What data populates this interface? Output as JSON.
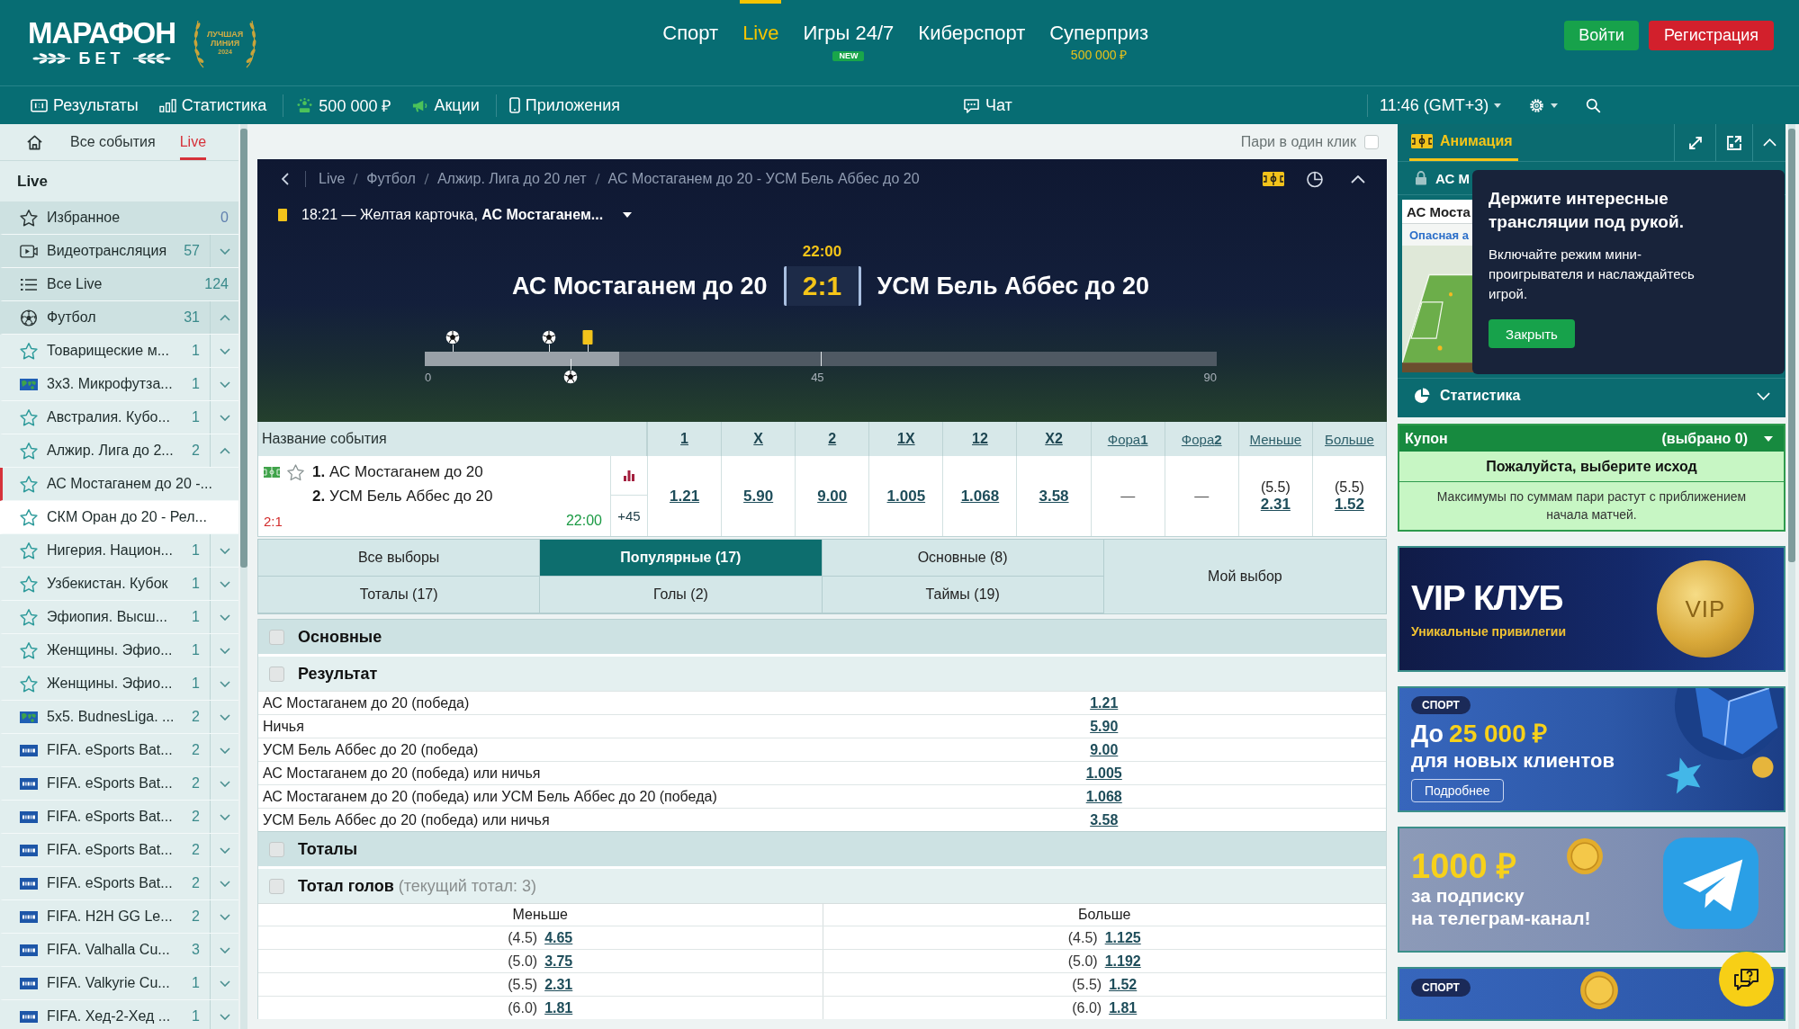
{
  "header": {
    "logo": {
      "title": "МАРАФОН",
      "subtitle": "БЕТ"
    },
    "award": [
      "ЛУЧШАЯ",
      "ЛИНИЯ",
      "2024"
    ],
    "nav": [
      {
        "label": "Спорт",
        "selected": false
      },
      {
        "label": "Live",
        "selected": true
      },
      {
        "label": "Игры 24/7",
        "selected": false,
        "badge": "NEW"
      },
      {
        "label": "Киберспорт",
        "selected": false
      },
      {
        "label": "Суперприз",
        "selected": false,
        "sublabel": "500 000 ₽"
      }
    ],
    "buttons": [
      {
        "label": "Войти",
        "kind": "login"
      },
      {
        "label": "Регистрация",
        "kind": "register"
      }
    ]
  },
  "toolbar": {
    "left": [
      [
        {
          "label": "Результаты",
          "kind": "results"
        },
        {
          "label": "Статистика",
          "kind": "stats"
        }
      ],
      [
        {
          "label": "500 000 ₽",
          "kind": "prize"
        },
        {
          "label": "Акции",
          "kind": "promo"
        }
      ],
      [
        {
          "label": "Приложения",
          "kind": "apps"
        }
      ]
    ],
    "right": [
      [
        {
          "label": "Чат",
          "kind": "chat"
        }
      ],
      [
        {
          "label": "11:46 (GMT+3)",
          "kind": "time"
        },
        {
          "kind": "settings"
        },
        {
          "kind": "search"
        }
      ]
    ]
  },
  "sidebar": {
    "tabs": [
      {
        "label": "Все события",
        "selected": false
      },
      {
        "label": "Live",
        "selected": true
      }
    ],
    "title": "Live",
    "items": [
      {
        "label": "Избранное",
        "kind": "favorites",
        "count": "0",
        "selected": false
      },
      {
        "label": "Видеотрансляция",
        "kind": "video",
        "count": "57",
        "expanded": false,
        "selected": false
      },
      {
        "label": "Все Live",
        "kind": "all",
        "count": "124",
        "selected": false
      },
      {
        "label": "Футбол",
        "kind": "sport",
        "count": "31",
        "expanded": true,
        "selected": false,
        "children": [
          {
            "label": "Товарищеские м...",
            "kind": "star",
            "count": "1",
            "expanded": false,
            "selected": false
          },
          {
            "label": "3x3. Микрофутза...",
            "kind": "world",
            "count": "1",
            "expanded": false,
            "selected": false
          },
          {
            "label": "Австралия. Кубо...",
            "kind": "star",
            "count": "1",
            "expanded": false,
            "selected": false
          },
          {
            "label": "Алжир. Лига до 2...",
            "kind": "star",
            "count": "2",
            "expanded": true,
            "selected": false,
            "children": [
              {
                "label": "АС Мостаганем до 20 -...",
                "kind": "star",
                "selected": true,
                "hovered": false
              },
              {
                "label": "СКМ Оран до 20 - Рел...",
                "kind": "star",
                "selected": false,
                "hovered": true
              }
            ]
          },
          {
            "label": "Нигерия. Национ...",
            "kind": "star",
            "count": "1",
            "expanded": false,
            "selected": false
          },
          {
            "label": "Узбекистан. Кубок",
            "kind": "star",
            "count": "1",
            "expanded": false,
            "selected": false
          },
          {
            "label": "Эфиопия. Высш...",
            "kind": "star",
            "count": "1",
            "expanded": false,
            "selected": false
          },
          {
            "label": "Женщины. Эфио...",
            "kind": "star",
            "count": "1",
            "expanded": false,
            "selected": false
          },
          {
            "label": "Женщины. Эфио...",
            "kind": "star",
            "count": "1",
            "expanded": false,
            "selected": false
          },
          {
            "label": "5x5. BudnesLiga. ...",
            "kind": "world",
            "count": "2",
            "expanded": false,
            "selected": false
          },
          {
            "label": "FIFA. eSports Bat...",
            "kind": "fifa",
            "count": "2",
            "expanded": false,
            "selected": false
          },
          {
            "label": "FIFA. eSports Bat...",
            "kind": "fifa",
            "count": "2",
            "expanded": false,
            "selected": false
          },
          {
            "label": "FIFA. eSports Bat...",
            "kind": "fifa",
            "count": "2",
            "expanded": false,
            "selected": false
          },
          {
            "label": "FIFA. eSports Bat...",
            "kind": "fifa",
            "count": "2",
            "expanded": false,
            "selected": false
          },
          {
            "label": "FIFA. eSports Bat...",
            "kind": "fifa",
            "count": "2",
            "expanded": false,
            "selected": false
          },
          {
            "label": "FIFA. H2H GG Le...",
            "kind": "fifa",
            "count": "2",
            "expanded": false,
            "selected": false
          },
          {
            "label": "FIFA. Valhalla Cu...",
            "kind": "fifa",
            "count": "3",
            "expanded": false,
            "selected": false
          },
          {
            "label": "FIFA. Valkyrie Cu...",
            "kind": "fifa",
            "count": "1",
            "expanded": false,
            "selected": false
          },
          {
            "label": "FIFA. Хед-2-Хед ...",
            "kind": "fifa",
            "count": "1",
            "expanded": false,
            "selected": false
          }
        ]
      }
    ]
  },
  "one_click": {
    "label": "Пари в один клик",
    "checked": false
  },
  "event": {
    "breadcrumbs": [
      "Live",
      "Футбол",
      "Алжир. Лига до 20 лет",
      "АС Мостаганем до 20 - УСМ Бель Аббес до 20"
    ],
    "incident": "18:21 — Желтая карточка, **АС Мостаганем...**",
    "clock": "22:00",
    "home": "АС Мостаганем до 20",
    "score": "2:1",
    "away": "УСМ Бель Аббес до 20",
    "timeline": {
      "level": 0.246,
      "ticks": [
        "0",
        "45",
        "90"
      ],
      "events": [
        {
          "kind": "goal-home",
          "level": 0.035
        },
        {
          "kind": "goal-home",
          "level": 0.157
        },
        {
          "kind": "goal-away",
          "level": 0.184
        },
        {
          "kind": "card-home",
          "level": 0.206
        }
      ]
    }
  },
  "odds_table": {
    "name_header": "Название события",
    "columns": [
      {
        "label": "1",
        "kind": "outcome"
      },
      {
        "label": "X",
        "kind": "outcome"
      },
      {
        "label": "2",
        "kind": "outcome"
      },
      {
        "label": "1X",
        "kind": "outcome"
      },
      {
        "label": "12",
        "kind": "outcome"
      },
      {
        "label": "X2",
        "kind": "outcome"
      },
      {
        "label": "Фора**1**",
        "kind": "handicap"
      },
      {
        "label": "Фора**2**",
        "kind": "handicap"
      },
      {
        "label": "Меньше",
        "kind": "total"
      },
      {
        "label": "Больше",
        "kind": "total"
      }
    ],
    "rows": [
      {
        "teams": [
          "**1.** АС Мостаганем до 20",
          "**2.** УСМ Бель Аббес до 20"
        ],
        "favorite": false,
        "score": "2:1",
        "time": "22:00",
        "more": "+45",
        "odds": [
          {
            "kind": "price",
            "value": "1.21"
          },
          {
            "kind": "price",
            "value": "5.90"
          },
          {
            "kind": "price",
            "value": "9.00"
          },
          {
            "kind": "price",
            "value": "1.005"
          },
          {
            "kind": "price",
            "value": "1.068"
          },
          {
            "kind": "price",
            "value": "3.58"
          },
          {
            "kind": "empty",
            "value": "—"
          },
          {
            "kind": "empty",
            "value": "—"
          },
          {
            "kind": "total",
            "line": "(5.5)",
            "value": "2.31"
          },
          {
            "kind": "total",
            "line": "(5.5)",
            "value": "1.52"
          }
        ]
      }
    ]
  },
  "market_tabs": {
    "tabs": [
      {
        "label": "Все выборы",
        "selected": false
      },
      {
        "label": "Популярные (17)",
        "selected": true
      },
      {
        "label": "Основные (8)",
        "selected": false
      },
      {
        "label": "Тоталы (17)",
        "selected": false
      },
      {
        "label": "Голы (2)",
        "selected": false
      },
      {
        "label": "Таймы (19)",
        "selected": false
      }
    ],
    "my_choice": "Мой выбор"
  },
  "markets": [
    {
      "kind": "group",
      "title": "Основные",
      "checked": false
    },
    {
      "kind": "market",
      "title": "Результат",
      "checked": false,
      "rows": [
        {
          "label": "АС Мостаганем до 20 (победа)",
          "odd": "1.21"
        },
        {
          "label": "Ничья",
          "odd": "5.90"
        },
        {
          "label": "УСМ Бель Аббес до 20 (победа)",
          "odd": "9.00"
        },
        {
          "label": "АС Мостаганем до 20 (победа) или ничья",
          "odd": "1.005"
        },
        {
          "label": "АС Мостаганем до 20 (победа) или УСМ Бель Аббес до 20 (победа)",
          "odd": "1.068"
        },
        {
          "label": "УСМ Бель Аббес до 20 (победа) или ничья",
          "odd": "3.58"
        }
      ]
    },
    {
      "kind": "group",
      "title": "Тоталы",
      "checked": false
    },
    {
      "kind": "totals",
      "title": "**Тотал голов** (текущий тотал: 3)",
      "checked": false,
      "columns": [
        "Меньше",
        "Больше"
      ],
      "rows": [
        [
          {
            "line": "(4.5)",
            "odd": "4.65"
          },
          {
            "line": "(4.5)",
            "odd": "1.125"
          }
        ],
        [
          {
            "line": "(5.0)",
            "odd": "3.75"
          },
          {
            "line": "(5.0)",
            "odd": "1.192"
          }
        ],
        [
          {
            "line": "(5.5)",
            "odd": "2.31"
          },
          {
            "line": "(5.5)",
            "odd": "1.52"
          }
        ],
        [
          {
            "line": "(6.0)",
            "odd": "1.81"
          },
          {
            "line": "(6.0)",
            "odd": "1.81"
          }
        ]
      ]
    }
  ],
  "animation": {
    "tab": {
      "label": "Анимация",
      "selected": true
    },
    "match": "АС М",
    "frame": {
      "team": "АС Моста",
      "status": "Опасная а"
    }
  },
  "popup": {
    "title": "Держите интересные трансляции под рукой.",
    "text": "Включайте режим мини-проигрывателя и наслаждайтесь игрой.",
    "button": "Закрыть"
  },
  "statistics": {
    "label": "Статистика",
    "expanded": false
  },
  "coupon": {
    "title": "Купон",
    "count": "(выбрано 0)",
    "prompt": "Пожалуйста, выберите исход",
    "note": "Максимумы по суммам пари растут с приближением начала матчей."
  },
  "banners": [
    {
      "kind": "vip",
      "title": "VIP КЛУБ",
      "subtitle": "Уникальные привилегии",
      "coin": "VIP"
    },
    {
      "kind": "bonus",
      "tag": "СПОРТ",
      "lead": "До",
      "amount": "25 000 ₽",
      "subtitle": "для новых клиентов",
      "button": "Подробнее"
    },
    {
      "kind": "telegram",
      "amount": "1000 ₽",
      "lines": [
        "за подписку",
        "на телеграм-канал!"
      ]
    },
    {
      "kind": "teaser",
      "tag": "СПОРТ"
    }
  ]
}
